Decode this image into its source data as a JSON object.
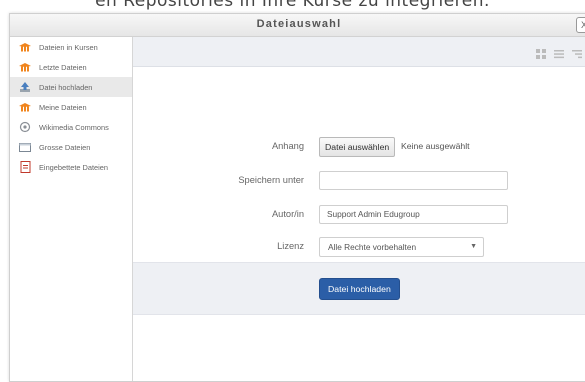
{
  "background": {
    "heading": "en Repositories in Ihre Kurse zu integrieren."
  },
  "window": {
    "title": "Dateiauswahl",
    "close_label": "X"
  },
  "sidebar": {
    "items": [
      {
        "label": "Dateien in Kursen",
        "icon": "moodle-hat-icon"
      },
      {
        "label": "Letzte Dateien",
        "icon": "moodle-hat-icon"
      },
      {
        "label": "Datei hochladen",
        "icon": "upload-icon",
        "active": true
      },
      {
        "label": "Meine Dateien",
        "icon": "moodle-hat-icon"
      },
      {
        "label": "Wikimedia Commons",
        "icon": "wikimedia-icon"
      },
      {
        "label": "Grosse Dateien",
        "icon": "folder-icon"
      },
      {
        "label": "Eingebettete Dateien",
        "icon": "file-icon"
      }
    ]
  },
  "toolbar": {
    "icons": [
      "grid-view-icon",
      "list-view-icon",
      "tree-view-icon"
    ]
  },
  "form": {
    "attachment": {
      "label": "Anhang",
      "button": "Datei auswählen",
      "status": "Keine ausgewählt"
    },
    "save_as": {
      "label": "Speichern unter",
      "value": ""
    },
    "author": {
      "label": "Autor/in",
      "value": "Support Admin Edugroup"
    },
    "license": {
      "label": "Lizenz",
      "selected": "Alle Rechte vorbehalten"
    },
    "upload_button": "Datei hochladen"
  },
  "colors": {
    "accent": "#2b5ea7",
    "toolbar_bg": "#eef0f4",
    "active_item_bg": "#e9e9e9"
  }
}
